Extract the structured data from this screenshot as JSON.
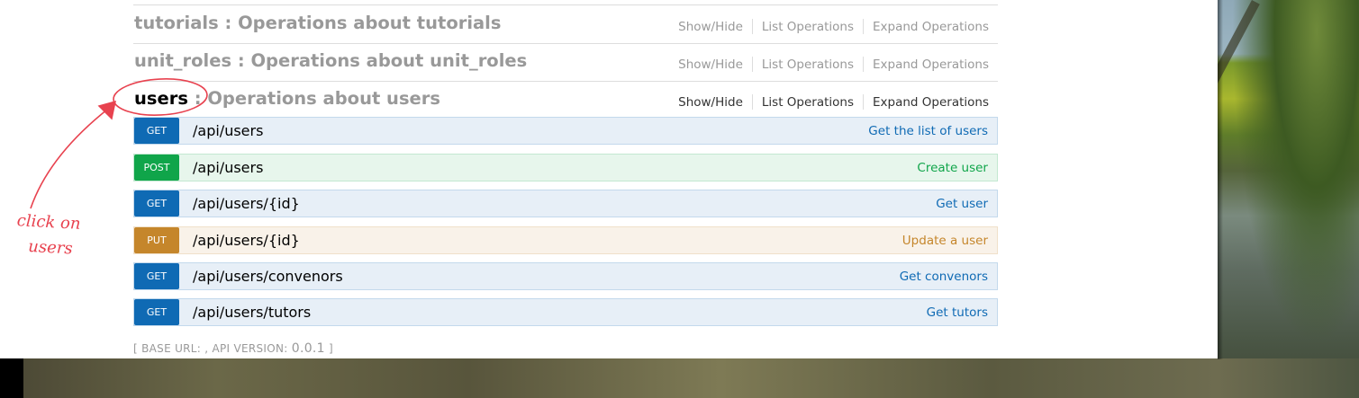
{
  "resources": [
    {
      "name": "tutorials",
      "description": ": Operations about tutorials",
      "active": false
    },
    {
      "name": "unit_roles",
      "description": ": Operations about unit_roles",
      "active": false
    },
    {
      "name": "users",
      "description": ": Operations about users",
      "active": true
    }
  ],
  "resource_actions": {
    "show_hide": "Show/Hide",
    "list_operations": "List Operations",
    "expand_operations": "Expand Operations"
  },
  "operations": [
    {
      "method": "GET",
      "path": "/api/users",
      "summary": "Get the list of users"
    },
    {
      "method": "POST",
      "path": "/api/users",
      "summary": "Create user"
    },
    {
      "method": "GET",
      "path": "/api/users/{id}",
      "summary": "Get user"
    },
    {
      "method": "PUT",
      "path": "/api/users/{id}",
      "summary": "Update a user"
    },
    {
      "method": "GET",
      "path": "/api/users/convenors",
      "summary": "Get convenors"
    },
    {
      "method": "GET",
      "path": "/api/users/tutors",
      "summary": "Get tutors"
    }
  ],
  "footer": {
    "open": "[ ",
    "base_url_label": "BASE URL: , API VERSION: ",
    "api_version": "0.0.1",
    "close": " ]"
  },
  "annotation": {
    "line1": "click on",
    "line2": "users",
    "color": "#e8424f"
  },
  "colors": {
    "get": "#0f6ab4",
    "post": "#10a54a",
    "put": "#c5862b"
  }
}
